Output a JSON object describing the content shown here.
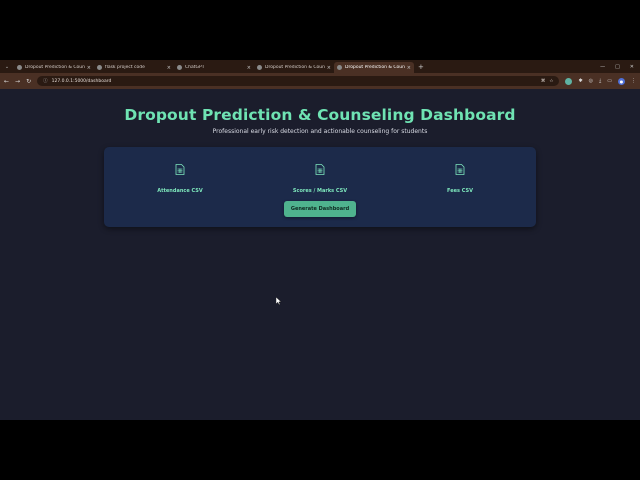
{
  "browser": {
    "tabs": [
      {
        "title": "Dropout Prediction & Counseli",
        "active": false
      },
      {
        "title": "flask project code",
        "active": false
      },
      {
        "title": "ChatGPT",
        "active": false
      },
      {
        "title": "Dropout Prediction & Counseli",
        "active": false
      },
      {
        "title": "Dropout Prediction & Counseli",
        "active": true
      }
    ],
    "url": "127.0.0.1:5000/dashboard"
  },
  "page": {
    "title": "Dropout Prediction & Counseling Dashboard",
    "subtitle": "Professional early risk detection and actionable counseling for students",
    "uploads": [
      {
        "label": "Attendance CSV",
        "icon": "file-csv-icon"
      },
      {
        "label": "Scores / Marks CSV",
        "icon": "file-csv-icon"
      },
      {
        "label": "Fees CSV",
        "icon": "file-csv-icon"
      }
    ],
    "generate_button": "Generate Dashboard"
  },
  "colors": {
    "accent": "#6fe3b3",
    "button": "#4fb38e",
    "card": "#1c2a4a",
    "background": "#1b1d2c"
  }
}
